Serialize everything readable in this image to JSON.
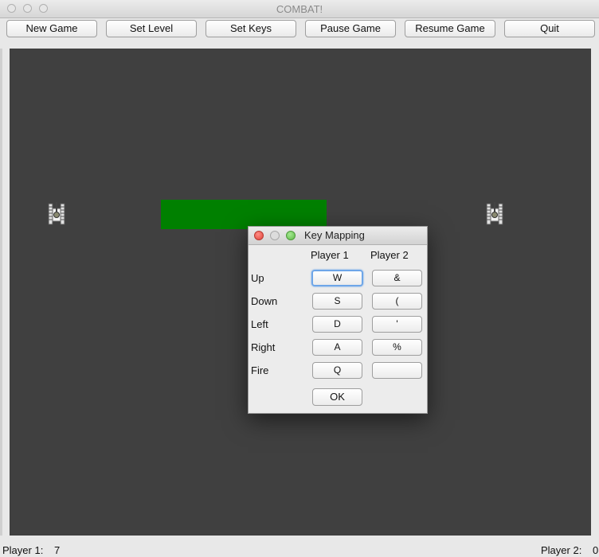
{
  "window": {
    "title": "COMBAT!"
  },
  "toolbar": {
    "buttons": [
      {
        "label": "New Game"
      },
      {
        "label": "Set Level"
      },
      {
        "label": "Set Keys"
      },
      {
        "label": "Pause Game"
      },
      {
        "label": "Resume Game"
      },
      {
        "label": "Quit"
      }
    ]
  },
  "arena": {
    "background_color": "#404040",
    "wall_color": "#008000"
  },
  "status": {
    "player1_label": "Player 1:",
    "player1_score": "7",
    "player2_label": "Player 2:",
    "player2_score": "0"
  },
  "dialog": {
    "title": "Key Mapping",
    "columns": [
      "Player 1",
      "Player 2"
    ],
    "rows": [
      {
        "label": "Up",
        "p1": "W",
        "p2": "&"
      },
      {
        "label": "Down",
        "p1": "S",
        "p2": "("
      },
      {
        "label": "Left",
        "p1": "D",
        "p2": "'"
      },
      {
        "label": "Right",
        "p1": "A",
        "p2": "%"
      },
      {
        "label": "Fire",
        "p1": "Q",
        "p2": ""
      }
    ],
    "ok_label": "OK"
  }
}
